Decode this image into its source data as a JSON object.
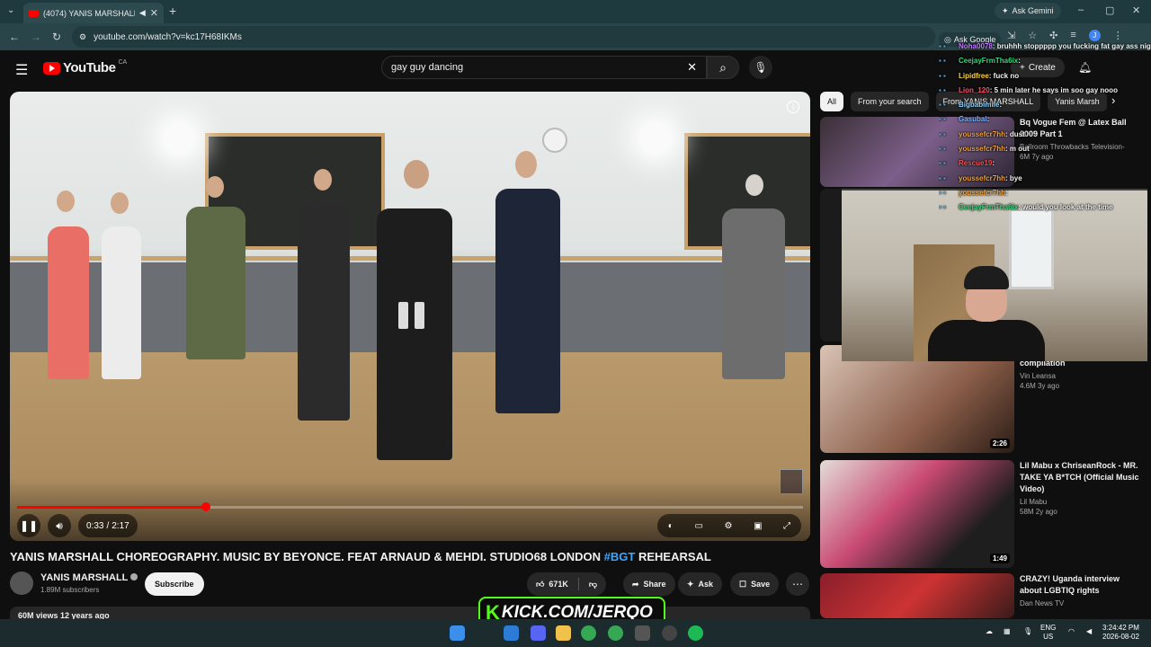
{
  "browser": {
    "tab_title": "(4074) YANIS MARSHALL CH",
    "new_tab": "+",
    "ask_gemini": "Ask Gemini",
    "url": "youtube.com/watch?v=kc17H68IKMs",
    "ask_google": "Ask Google",
    "profile_letter": "J"
  },
  "youtube": {
    "logo_text": "YouTube",
    "country": "CA",
    "search_query": "gay guy dancing",
    "create_label": "Create"
  },
  "player": {
    "time_current": "0:33",
    "time_total": "2:17",
    "progress": 0.24,
    "time_separator": "/"
  },
  "video": {
    "title": "YANIS MARSHALL CHOREOGRAPHY. MUSIC BY BEYONCE. FEAT ARNAUD & MEHDI. STUDIO68 LONDON",
    "hashtag": "#BGT",
    "title_suffix": "REHEARSAL",
    "channel": "YANIS MARSHALL",
    "subscribers": "1.89M subscribers",
    "subscribe_label": "Subscribe",
    "likes": "671K",
    "share_label": "Share",
    "ask_label": "Ask",
    "save_label": "Save",
    "views_date": "60M views  12 years ago"
  },
  "chips": [
    "All",
    "From your search",
    "From YANIS MARSHALL",
    "Yanis Marsh"
  ],
  "recommendations": [
    {
      "title": "Bq Vogue Fem @ Latex Ball 2009 Part 1",
      "channel": "Ballroom Throwbacks Television-",
      "stats": "6M  7y ago",
      "duration": ""
    },
    {
      "title": "compilation",
      "channel": "Vin Leansa",
      "stats": "4.6M  3y ago",
      "duration": "2:26"
    },
    {
      "title": "Lil Mabu x ChriseanRock - MR. TAKE YA B*TCH (Official Music Video)",
      "channel": "Lil Mabu",
      "stats": "58M  2y ago",
      "duration": "1:49"
    },
    {
      "title": "CRAZY! Uganda interview about LGBTIQ rights",
      "channel": "Dan News TV",
      "stats": "",
      "duration": ""
    }
  ],
  "chat": [
    {
      "user": "Noha0078",
      "color": "#c779ff",
      "msg": "bruhhh stoppppp you fucking fat gay ass nig"
    },
    {
      "user": "CeejayFrmTha6ix",
      "color": "#3ad87c",
      "msg": ""
    },
    {
      "user": "Lipidfree",
      "color": "#ffd23f",
      "msg": "fuck no"
    },
    {
      "user": "Lion_120",
      "color": "#ff4d6d",
      "msg": "5 min later he says im soo gay nooo"
    },
    {
      "user": "Bigbabimile",
      "color": "#8ad2ff",
      "msg": ""
    },
    {
      "user": "Gasubal",
      "color": "#7fb3ff",
      "msg": ""
    },
    {
      "user": "youssefcr7hh",
      "color": "#f2a33a",
      "msg": "dust"
    },
    {
      "user": "youssefcr7hh",
      "color": "#f2a33a",
      "msg": "m out"
    },
    {
      "user": "Rescue19",
      "color": "#ff4d4d",
      "msg": ""
    },
    {
      "user": "youssefcr7hh",
      "color": "#f2a33a",
      "msg": "bye"
    },
    {
      "user": "youssefcr7hh",
      "color": "#f2a33a",
      "msg": ""
    },
    {
      "user": "CeejayFrmTha6ix",
      "color": "#3ad87c",
      "msg": "would you look at the time"
    }
  ],
  "overlay": {
    "kick_k": "K",
    "kick_text": "KICK.COM/JERQO"
  },
  "taskbar": {
    "lang_top": "ENG",
    "lang_bottom": "US",
    "time": "3:24:42 PM",
    "date": "2026-08-02"
  },
  "colors": {
    "accent": "#ff0000",
    "link": "#3ea6ff",
    "kick_green": "#53fc18"
  }
}
